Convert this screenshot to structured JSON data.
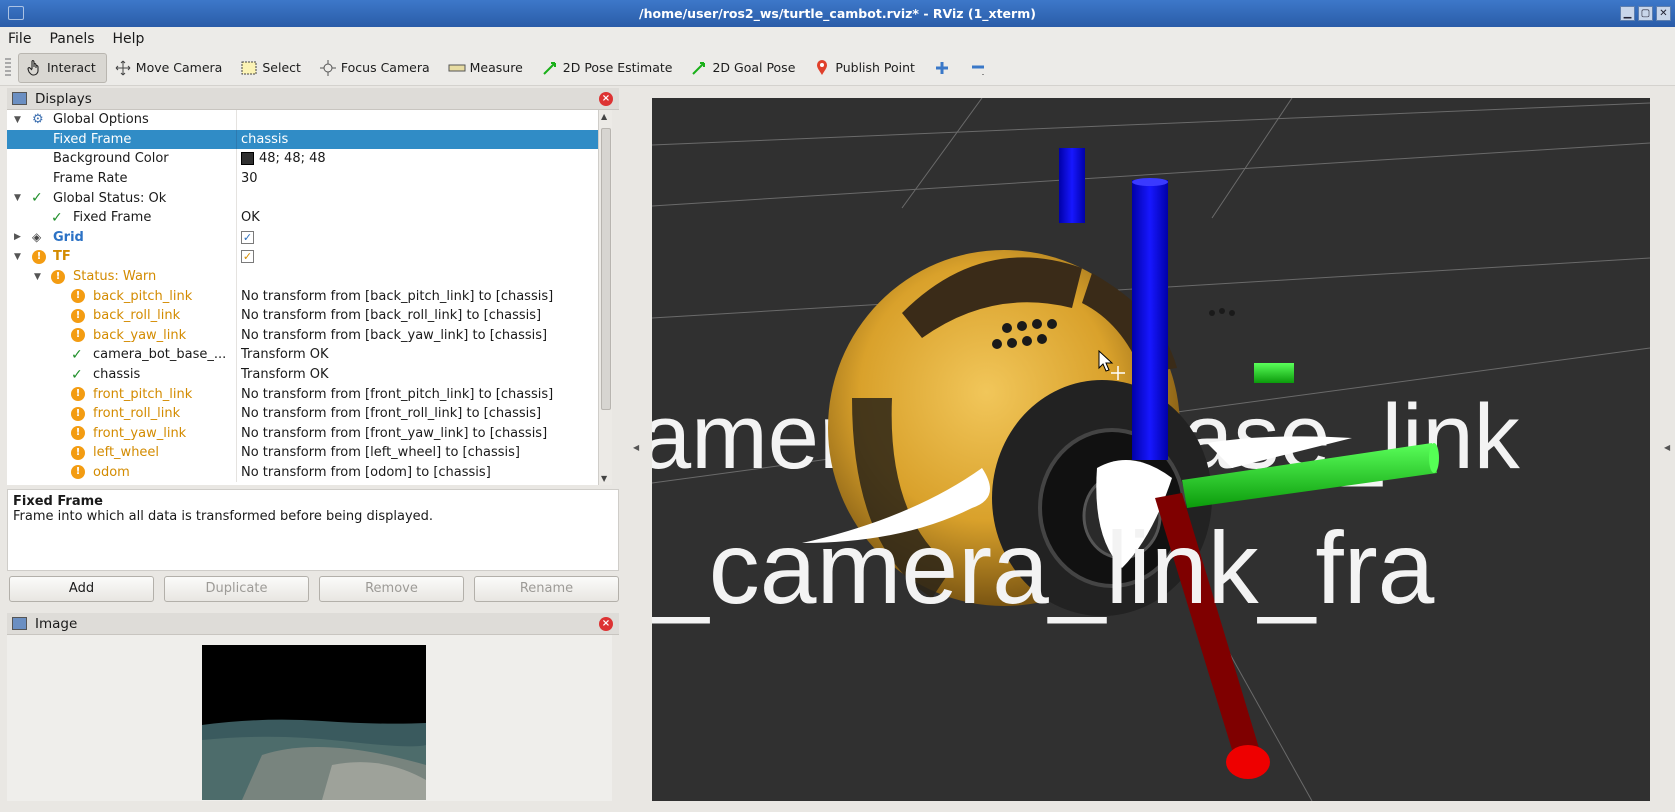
{
  "window": {
    "title": "/home/user/ros2_ws/turtle_cambot.rviz* - RViz (1_xterm)",
    "controls": [
      "▁",
      "▢",
      "✕"
    ]
  },
  "menu": [
    {
      "label": "File"
    },
    {
      "label": "Panels"
    },
    {
      "label": "Help"
    }
  ],
  "toolbar": {
    "tools": [
      {
        "label": "Interact",
        "icon": "hand-pointer-icon",
        "active": true
      },
      {
        "label": "Move Camera",
        "icon": "move-camera-icon"
      },
      {
        "label": "Select",
        "icon": "select-box-icon"
      },
      {
        "label": "Focus Camera",
        "icon": "focus-camera-icon"
      },
      {
        "label": "Measure",
        "icon": "ruler-icon"
      },
      {
        "label": "2D Pose Estimate",
        "icon": "pose-arrow-icon"
      },
      {
        "label": "2D Goal Pose",
        "icon": "goal-arrow-icon"
      },
      {
        "label": "Publish Point",
        "icon": "map-pin-icon"
      }
    ],
    "add_icon": "plus-icon",
    "remove_icon": "minus-icon"
  },
  "displays": {
    "title": "Displays",
    "rows": [
      {
        "label": "Global Options",
        "value": ""
      },
      {
        "label": "Fixed Frame",
        "value": "chassis"
      },
      {
        "label": "Background Color",
        "value": "48; 48; 48"
      },
      {
        "label": "Frame Rate",
        "value": "30"
      },
      {
        "label": "Global Status: Ok",
        "value": ""
      },
      {
        "label": "Fixed Frame",
        "value": "OK"
      },
      {
        "label": "Grid",
        "value": "✓"
      },
      {
        "label": "TF",
        "value": "✓"
      },
      {
        "label": "Status: Warn",
        "value": ""
      },
      {
        "label": "back_pitch_link",
        "value": "No transform from [back_pitch_link] to [chassis]"
      },
      {
        "label": "back_roll_link",
        "value": "No transform from [back_roll_link] to [chassis]"
      },
      {
        "label": "back_yaw_link",
        "value": "No transform from [back_yaw_link] to [chassis]"
      },
      {
        "label": "camera_bot_base_...",
        "value": "Transform OK"
      },
      {
        "label": "chassis",
        "value": "Transform OK"
      },
      {
        "label": "front_pitch_link",
        "value": "No transform from [front_pitch_link] to [chassis]"
      },
      {
        "label": "front_roll_link",
        "value": "No transform from [front_roll_link] to [chassis]"
      },
      {
        "label": "front_yaw_link",
        "value": "No transform from [front_yaw_link] to [chassis]"
      },
      {
        "label": "left_wheel",
        "value": "No transform from [left_wheel] to [chassis]"
      },
      {
        "label": "odom",
        "value": "No transform from [odom] to [chassis]"
      }
    ],
    "background_color_hex": "#303030"
  },
  "description": {
    "title": "Fixed Frame",
    "text": "Frame into which all data is transformed before being displayed."
  },
  "buttons": {
    "add": "Add",
    "duplicate": "Duplicate",
    "remove": "Remove",
    "rename": "Rename"
  },
  "image_panel": {
    "title": "Image"
  },
  "viewport": {
    "label_base": "amera_bot_base_link",
    "label_camera": "_camera_link_fra",
    "colors": {
      "background": "#303030",
      "x_axis": "#8b0000",
      "y_axis": "#14d414",
      "z_axis": "#0000e0",
      "robot_body": "#e0a928"
    }
  }
}
